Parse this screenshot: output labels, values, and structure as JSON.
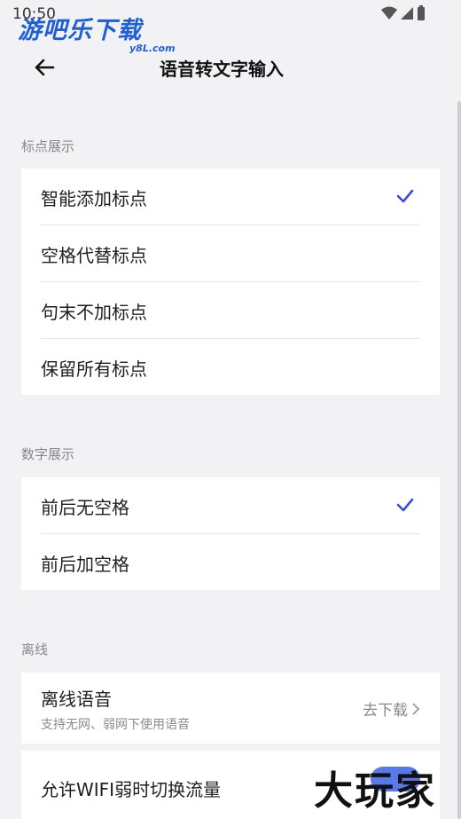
{
  "status_bar": {
    "time": "10:50"
  },
  "watermark": {
    "top_main": "游吧乐下载",
    "top_sub": "y8L.com",
    "bottom": "大玩家"
  },
  "header": {
    "title": "语音转文字输入"
  },
  "punctuation": {
    "title": "标点展示",
    "options": [
      {
        "label": "智能添加标点",
        "selected": true
      },
      {
        "label": "空格代替标点",
        "selected": false
      },
      {
        "label": "句末不加标点",
        "selected": false
      },
      {
        "label": "保留所有标点",
        "selected": false
      }
    ]
  },
  "numbers": {
    "title": "数字展示",
    "options": [
      {
        "label": "前后无空格",
        "selected": true
      },
      {
        "label": "前后加空格",
        "selected": false
      }
    ]
  },
  "offline": {
    "title": "离线",
    "item_label": "离线语音",
    "item_sub": "支持无网、弱网下使用语音",
    "action": "去下载"
  },
  "wifi": {
    "label": "允许WIFI弱时切换流量"
  },
  "colors": {
    "accent": "#3b4fd8",
    "background": "#f2f2f4",
    "card": "#ffffff"
  }
}
